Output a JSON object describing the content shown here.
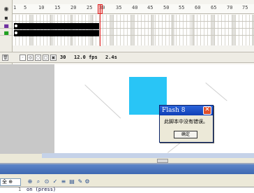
{
  "timeline": {
    "ruler_numbers": [
      "1",
      "5",
      "10",
      "15",
      "20",
      "25",
      "30",
      "35",
      "40",
      "45",
      "50",
      "55",
      "60",
      "65",
      "70",
      "75"
    ],
    "current_frame": "30",
    "fps": "12.0 fps",
    "elapsed": "2.4s"
  },
  "dialog": {
    "title": "Flash 8",
    "message": "此脚本中没有错误。",
    "ok_label": "确定",
    "close_glyph": "✕"
  },
  "actions": {
    "selector_value": "全 ⊕",
    "code_line_number": "1",
    "code_text": "on (press)"
  },
  "colors": {
    "accent_square": "#29c5f6",
    "title_bar": "#0f3fb6",
    "playhead": "#e02020"
  }
}
